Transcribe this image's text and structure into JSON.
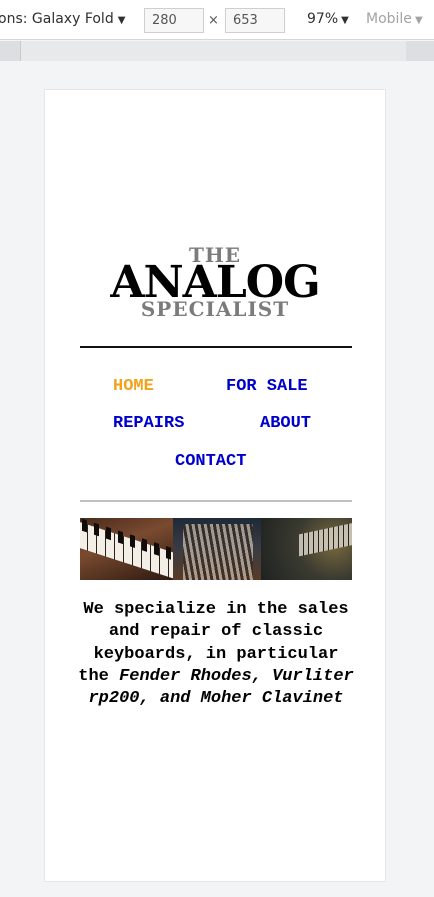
{
  "devtools": {
    "device_label": "ons: Galaxy Fold",
    "width_value": "280",
    "height_value": "653",
    "times_symbol": "×",
    "zoom": "97%",
    "mode": "Mobile",
    "dropdown_arrow": "▼"
  },
  "site": {
    "logo": {
      "the": "THE",
      "main": "ANALOG",
      "sub": "SPECIALIST"
    },
    "nav": {
      "home": "HOME",
      "for_sale": "FOR SALE",
      "repairs": "REPAIRS",
      "about": "ABOUT",
      "contact": "CONTACT"
    },
    "intro": {
      "plain": "We specialize in the sales and repair of classic keyboards, in particular the ",
      "emphasis": "Fender Rhodes, Vurliter rp200, and Moher Clavinet"
    }
  },
  "colors": {
    "nav_link": "#0000cd",
    "nav_active": "#f3a21c",
    "logo_grey": "#7b7b7b"
  }
}
